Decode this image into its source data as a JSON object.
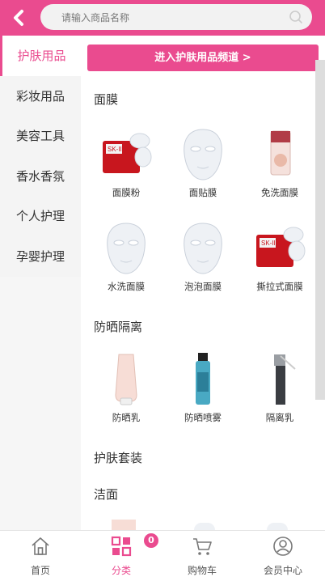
{
  "header": {
    "search_placeholder": "请输入商品名称"
  },
  "sidebar": {
    "items": [
      {
        "label": "护肤用品",
        "active": true
      },
      {
        "label": "彩妆用品"
      },
      {
        "label": "美容工具"
      },
      {
        "label": "香水香氛"
      },
      {
        "label": "个人护理"
      },
      {
        "label": "孕婴护理"
      }
    ]
  },
  "main": {
    "banner": "进入护肤用品频道 >",
    "sections": [
      {
        "title": "面膜",
        "products": [
          "面膜粉",
          "面贴膜",
          "免洗面膜",
          "水洗面膜",
          "泡泡面膜",
          "撕拉式面膜"
        ]
      },
      {
        "title": "防晒隔离",
        "products": [
          "防晒乳",
          "防晒喷雾",
          "隔离乳"
        ]
      },
      {
        "title": "护肤套装",
        "products": []
      },
      {
        "title": "洁面",
        "products": []
      }
    ]
  },
  "tabbar": {
    "items": [
      {
        "label": "首页",
        "icon": "home-icon"
      },
      {
        "label": "分类",
        "icon": "category-icon",
        "active": true
      },
      {
        "label": "购物车",
        "icon": "cart-icon"
      },
      {
        "label": "会员中心",
        "icon": "user-icon"
      }
    ],
    "cart_badge": "0"
  },
  "colors": {
    "accent": "#ea4b8f"
  }
}
